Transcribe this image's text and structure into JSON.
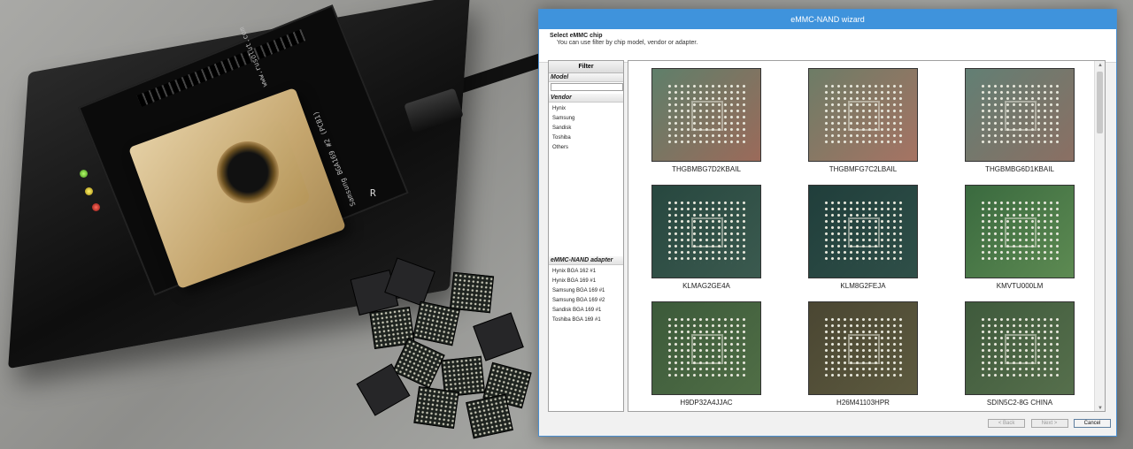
{
  "window": {
    "title": "eMMC-NAND wizard"
  },
  "header": {
    "title": "Select eMMC chip",
    "subtitle": "You can use filter by chip model, vendor or adapter."
  },
  "filter": {
    "heading": "Filter",
    "model_label": "Model",
    "model_value": "",
    "vendor_label": "Vendor",
    "vendors": [
      "Hynix",
      "Samsung",
      "Sandisk",
      "Toshiba",
      "Others"
    ],
    "adapter_label": "eMMC-NAND adapter",
    "adapters": [
      "Hynix BGA 162 #1",
      "Hynix BGA 169 #1",
      "Samsung BGA 169 #1",
      "Samsung BGA 169 #2",
      "Sandisk BGA 169 #1",
      "Toshiba BGA 169 #1"
    ]
  },
  "chips": [
    {
      "name": "THGBMBG7D2KBAIL",
      "color": "#5f7f6a",
      "accent": "#9b6a5a"
    },
    {
      "name": "THGBMFG7C2LBAIL",
      "color": "#6d7c66",
      "accent": "#a67363"
    },
    {
      "name": "THGBMBG6D1KBAIL",
      "color": "#627f74",
      "accent": "#8b6f63"
    },
    {
      "name": "KLMAG2GE4A",
      "color": "#27473f",
      "accent": "#3b5a4f"
    },
    {
      "name": "KLM8G2FEJA",
      "color": "#203e3b",
      "accent": "#2f4f48"
    },
    {
      "name": "KMVTU000LM",
      "color": "#3a6a3f",
      "accent": "#5d8a52"
    },
    {
      "name": "H9DP32A4JJAC",
      "color": "#3c5a3a",
      "accent": "#506e46"
    },
    {
      "name": "H26M41103HPR",
      "color": "#4a4632",
      "accent": "#5d5a3f"
    },
    {
      "name": "SDIN5C2-8G CHINA",
      "color": "#3f5a3c",
      "accent": "#566f4c"
    }
  ],
  "buttons": {
    "back": "< Back",
    "next": "Next >",
    "cancel": "Cancel"
  },
  "photo": {
    "pcb_label_1": "Samsung BGA169 #2 (PCB1)",
    "pcb_label_2": "www.rusolut.com",
    "brand_fragment": "R"
  }
}
